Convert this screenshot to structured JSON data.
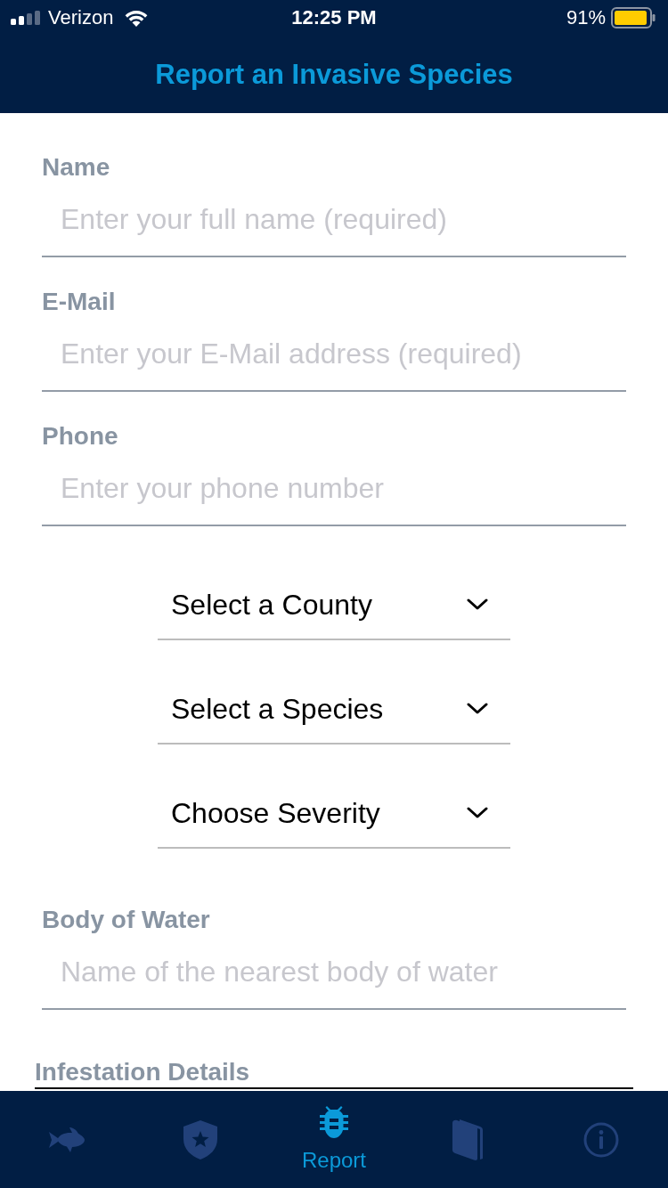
{
  "status_bar": {
    "carrier": "Verizon",
    "time": "12:25 PM",
    "battery": "91%"
  },
  "nav_bar": {
    "title": "Report an Invasive Species"
  },
  "form": [
    {
      "kind": "text_field",
      "label": "Name",
      "placeholder": "Enter your full name (required)"
    },
    {
      "kind": "text_field",
      "label": "E-Mail",
      "placeholder": "Enter your E-Mail address (required)"
    },
    {
      "kind": "text_field",
      "label": "Phone",
      "placeholder": "Enter your phone number"
    },
    {
      "kind": "picker",
      "value": "Select a County"
    },
    {
      "kind": "picker",
      "value": "Select a Species"
    },
    {
      "kind": "picker",
      "value": "Choose Severity"
    },
    {
      "kind": "text_field",
      "label": "Body of Water",
      "placeholder": "Name of the nearest body of water"
    },
    {
      "kind": "text_area",
      "label": "Infestation Details"
    }
  ],
  "tab_bar": [
    {
      "selected": false
    },
    {
      "selected": false
    },
    {
      "label": "Report",
      "selected": true
    },
    {
      "selected": false
    },
    {
      "selected": false
    }
  ]
}
